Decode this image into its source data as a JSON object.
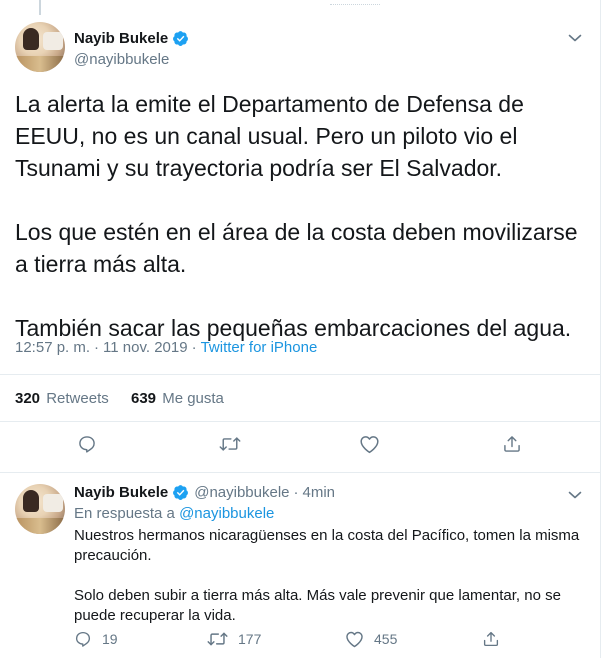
{
  "main_tweet": {
    "display_name": "Nayib Bukele",
    "handle": "@nayibbukele",
    "paragraphs": [
      "La alerta la emite el Departamento de Defensa de EEUU, no es un canal usual. Pero un piloto vio el Tsunami y su trayectoria podría ser El Salvador.",
      "Los que estén en el área de la costa deben movilizarse a tierra más alta.",
      "También sacar las pequeñas embarcaciones del agua."
    ],
    "time": "12:57 p. m.",
    "separator": "·",
    "date": "11 nov. 2019",
    "source": "Twitter for iPhone",
    "retweets_count": "320",
    "retweets_label": "Retweets",
    "likes_count": "639",
    "likes_label": "Me gusta"
  },
  "reply_tweet": {
    "display_name": "Nayib Bukele",
    "handle": "@nayibbukele",
    "separator": "·",
    "time_ago": "4min",
    "replying_prefix": "En respuesta a",
    "replying_to": "@nayibbukele",
    "paragraphs": [
      "Nuestros hermanos nicaragüenses en la costa del Pacífico, tomen la misma precaución.",
      "Solo deben subir a tierra más alta. Más vale prevenir que lamentar, no se puede recuperar la vida."
    ],
    "replies_count": "19",
    "retweets_count": "177",
    "likes_count": "455"
  },
  "icons": {
    "verified": "verified-badge-icon",
    "chevron": "chevron-down-icon",
    "reply": "reply-icon",
    "retweet": "retweet-icon",
    "like": "heart-icon",
    "share": "share-icon"
  },
  "colors": {
    "accent": "#1b95e0",
    "verified": "#1da1f2",
    "secondary_text": "#657786",
    "border": "#e6ecf0"
  }
}
